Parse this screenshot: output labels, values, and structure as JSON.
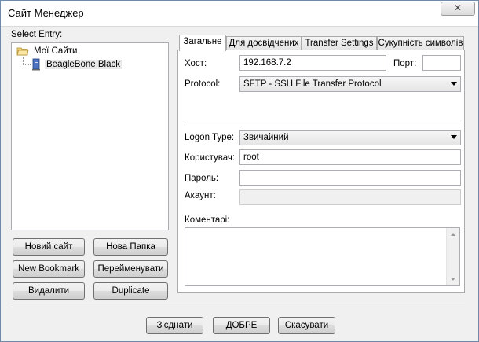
{
  "window": {
    "title": "Сайт Менеджер",
    "close_glyph": "✕"
  },
  "left": {
    "select_entry_label": "Select Entry:",
    "tree": {
      "root": {
        "label": "Мої Сайти",
        "icon": "folder-icon"
      },
      "children": [
        {
          "label": "BeagleBone Black",
          "icon": "server-icon"
        }
      ]
    },
    "buttons": {
      "new_site": "Новий сайт",
      "new_folder": "Нова Папка",
      "new_bookmark": "New Bookmark",
      "rename": "Перейменувати",
      "delete": "Видалити",
      "duplicate": "Duplicate"
    }
  },
  "tabs": [
    {
      "label": "Загальне",
      "active": true
    },
    {
      "label": "Для досвідчених",
      "active": false
    },
    {
      "label": "Transfer Settings",
      "active": false
    },
    {
      "label": "Сукупність символів",
      "active": false
    }
  ],
  "general": {
    "host_label": "Хост:",
    "host_value": "192.168.7.2",
    "port_label": "Порт:",
    "port_value": "",
    "protocol_label": "Protocol:",
    "protocol_value": "SFTP - SSH File Transfer Protocol",
    "logon_type_label": "Logon Type:",
    "logon_type_value": "Звичайний",
    "user_label": "Користувач:",
    "user_value": "root",
    "password_label": "Пароль:",
    "password_value": "",
    "account_label": "Акаунт:",
    "account_value": "",
    "comments_label": "Коментарі:",
    "comments_value": ""
  },
  "footer": {
    "connect": "З'єднати",
    "ok": "ДОБРЕ",
    "cancel": "Скасувати"
  }
}
